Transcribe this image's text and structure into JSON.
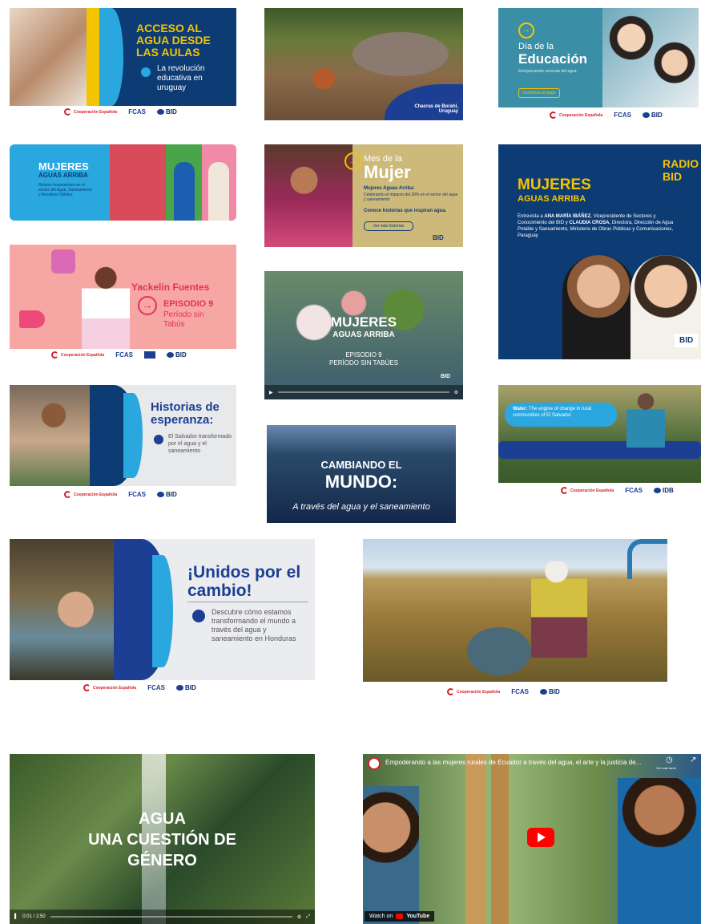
{
  "cards": {
    "acceso": {
      "title": "ACCESO AL AGUA DESDE LAS AULAS",
      "subtitle": "La revolución educativa en uruguay"
    },
    "cerdo": {
      "caption": "Chacras de Borahi, Uruguay"
    },
    "educacion": {
      "kicker": "Día de la",
      "title": "Educación",
      "subtitle": "Enriqueciendo escenas del agua",
      "cta": "Comienza al juego"
    },
    "mujeres_aa": {
      "title": "MUJERES",
      "subtitle": "AGUAS ARRIBA",
      "desc": "Relatos inspiradores en el sector del Agua, Saneamiento y Residuos Sólidos"
    },
    "mes_mujer": {
      "kicker": "Mes de la",
      "title": "Mujer",
      "line1": "Mujeres Aguas Arriba:",
      "line2": "Celebrando el impacto del 30% en el sector del agua y saneamiento",
      "line3": "Conoce historias que inspiran agua.",
      "cta": "Ver más historias"
    },
    "radio": {
      "brand": "RADIO BID",
      "title": "MUJERES",
      "subtitle": "AGUAS ARRIBA",
      "desc_intro": "Entrevista a ",
      "guest1": "ANA MARÍA IBÁÑEZ",
      "desc_mid": ", Vicepresidente de Sectores y Conocimiento del BID y ",
      "guest2": "CLAUDIA CROSA",
      "desc_end": ", Directora, Dirección de Agua Potable y Saneamiento, Ministerio de Obras Públicas y Comunicaciones, Paraguay"
    },
    "yackelin": {
      "name": "Yackelin Fuentes",
      "episode": "EPISODIO 9",
      "topic": "Período sin Tabús"
    },
    "video_mujeres": {
      "title": "MUJERES",
      "subtitle": "AGUAS ARRIBA",
      "episode": "EPISODIO 9",
      "topic": "PERÍODO SIN TABÚES"
    },
    "historias": {
      "title": "Historias de esperanza:",
      "desc": "El Salvador transformado por el agua y el saneamiento"
    },
    "cambiando": {
      "line1": "CAMBIANDO EL",
      "line2": "MUNDO:",
      "line3": "A través del agua y el saneamiento"
    },
    "water": {
      "text_bold": "Water:",
      "text": " The engine of change in rural communities of El Salvador"
    },
    "unidos": {
      "title": "¡Unidos por el cambio!",
      "desc": "Descubre cómo estamos transformando el mundo a través del agua y saneamiento en Honduras"
    },
    "genero": {
      "title1": "AGUA",
      "title2": "UNA CUESTIÓN DE",
      "title3": "GÉNERO",
      "time": "0:01 / 2:50"
    },
    "youtube": {
      "title": "Empoderando a las mujeres rurales de Ecuador a través del agua, el arte y la justicia de...",
      "watch_on": "Watch on",
      "yt": "YouTube",
      "watch_later": "Ver más tarde",
      "share": "Compartir"
    }
  },
  "logos": {
    "cooperacion": "Cooperación Española",
    "fcas": "FCAS",
    "bid": "BID",
    "idb": "IDB"
  },
  "colors": {
    "navy": "#0d3b73",
    "cyan": "#2aa7df",
    "yellow": "#f5c400",
    "pink": "#f4a3a6",
    "grey": "#e8e9eb"
  }
}
